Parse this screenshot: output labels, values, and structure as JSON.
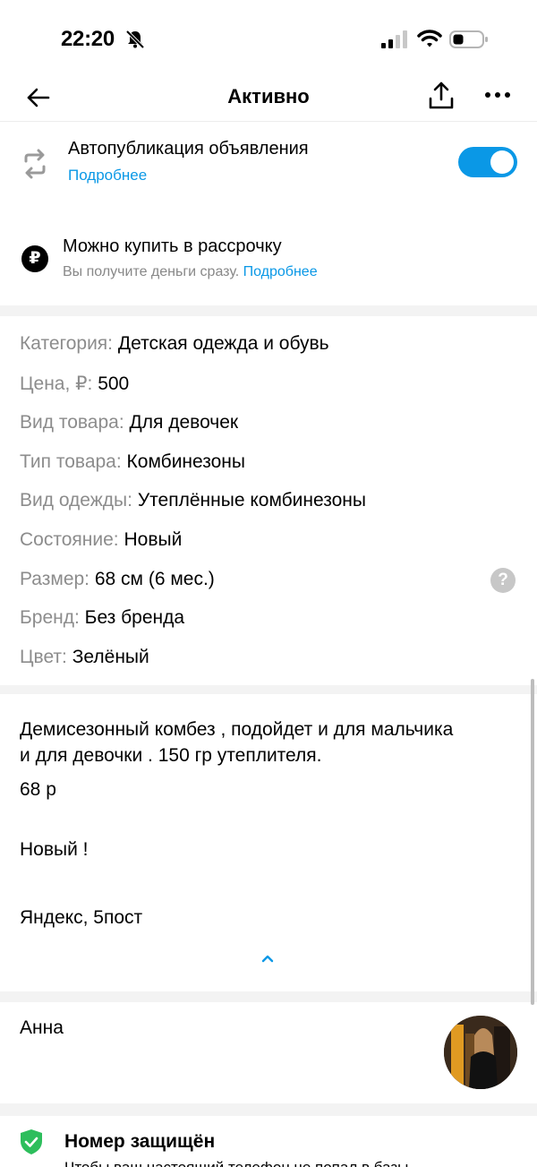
{
  "status_bar": {
    "time": "22:20"
  },
  "nav": {
    "title": "Активно"
  },
  "autopublish": {
    "title": "Автопубликация объявления",
    "link": "Подробнее",
    "enabled": true
  },
  "installment": {
    "icon_text": "₽",
    "title": "Можно купить в рассрочку",
    "subtitle": "Вы получите деньги сразу.",
    "link": "Подробнее"
  },
  "params": [
    {
      "label": "Категория:",
      "value": "Детская одежда и обувь"
    },
    {
      "label": "Цена, ₽:",
      "value": "500"
    },
    {
      "label": "Вид товара:",
      "value": "Для девочек"
    },
    {
      "label": "Тип товара:",
      "value": "Комбинезоны"
    },
    {
      "label": "Вид одежды:",
      "value": "Утеплённые комбинезоны"
    },
    {
      "label": "Состояние:",
      "value": "Новый"
    },
    {
      "label": "Размер:",
      "value": "68 см (6 мес.)"
    },
    {
      "label": "Бренд:",
      "value": "Без бренда"
    },
    {
      "label": "Цвет:",
      "value": "Зелёный"
    }
  ],
  "help": {
    "symbol": "?"
  },
  "description": {
    "line1": "Демисезонный комбез , подойдет и для мальчика",
    "line2": "и для девочки . 150 гр утеплителя.",
    "line3": "68 р",
    "line4": "Новый !",
    "line5": "Яндекс, 5пост"
  },
  "seller": {
    "name": "Анна"
  },
  "protected": {
    "title": "Номер защищён",
    "subtitle": "Чтобы ваш настоящий телефон не попал в базы"
  },
  "colors": {
    "accent": "#0a98e6",
    "muted": "#8c8c8c",
    "shield": "#2dbe5c"
  }
}
